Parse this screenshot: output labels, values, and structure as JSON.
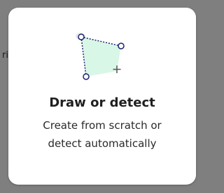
{
  "background_label_fragment": "ri",
  "card": {
    "title": "Draw or detect",
    "description_line1": "Create from scratch or",
    "description_line2": "detect automatically",
    "icon": "polygon-draw-icon"
  },
  "colors": {
    "overlay": "#7f7f7f",
    "card": "#ffffff",
    "polygon_fill": "#d9f7e6",
    "vertex_stroke": "#1b2570"
  }
}
